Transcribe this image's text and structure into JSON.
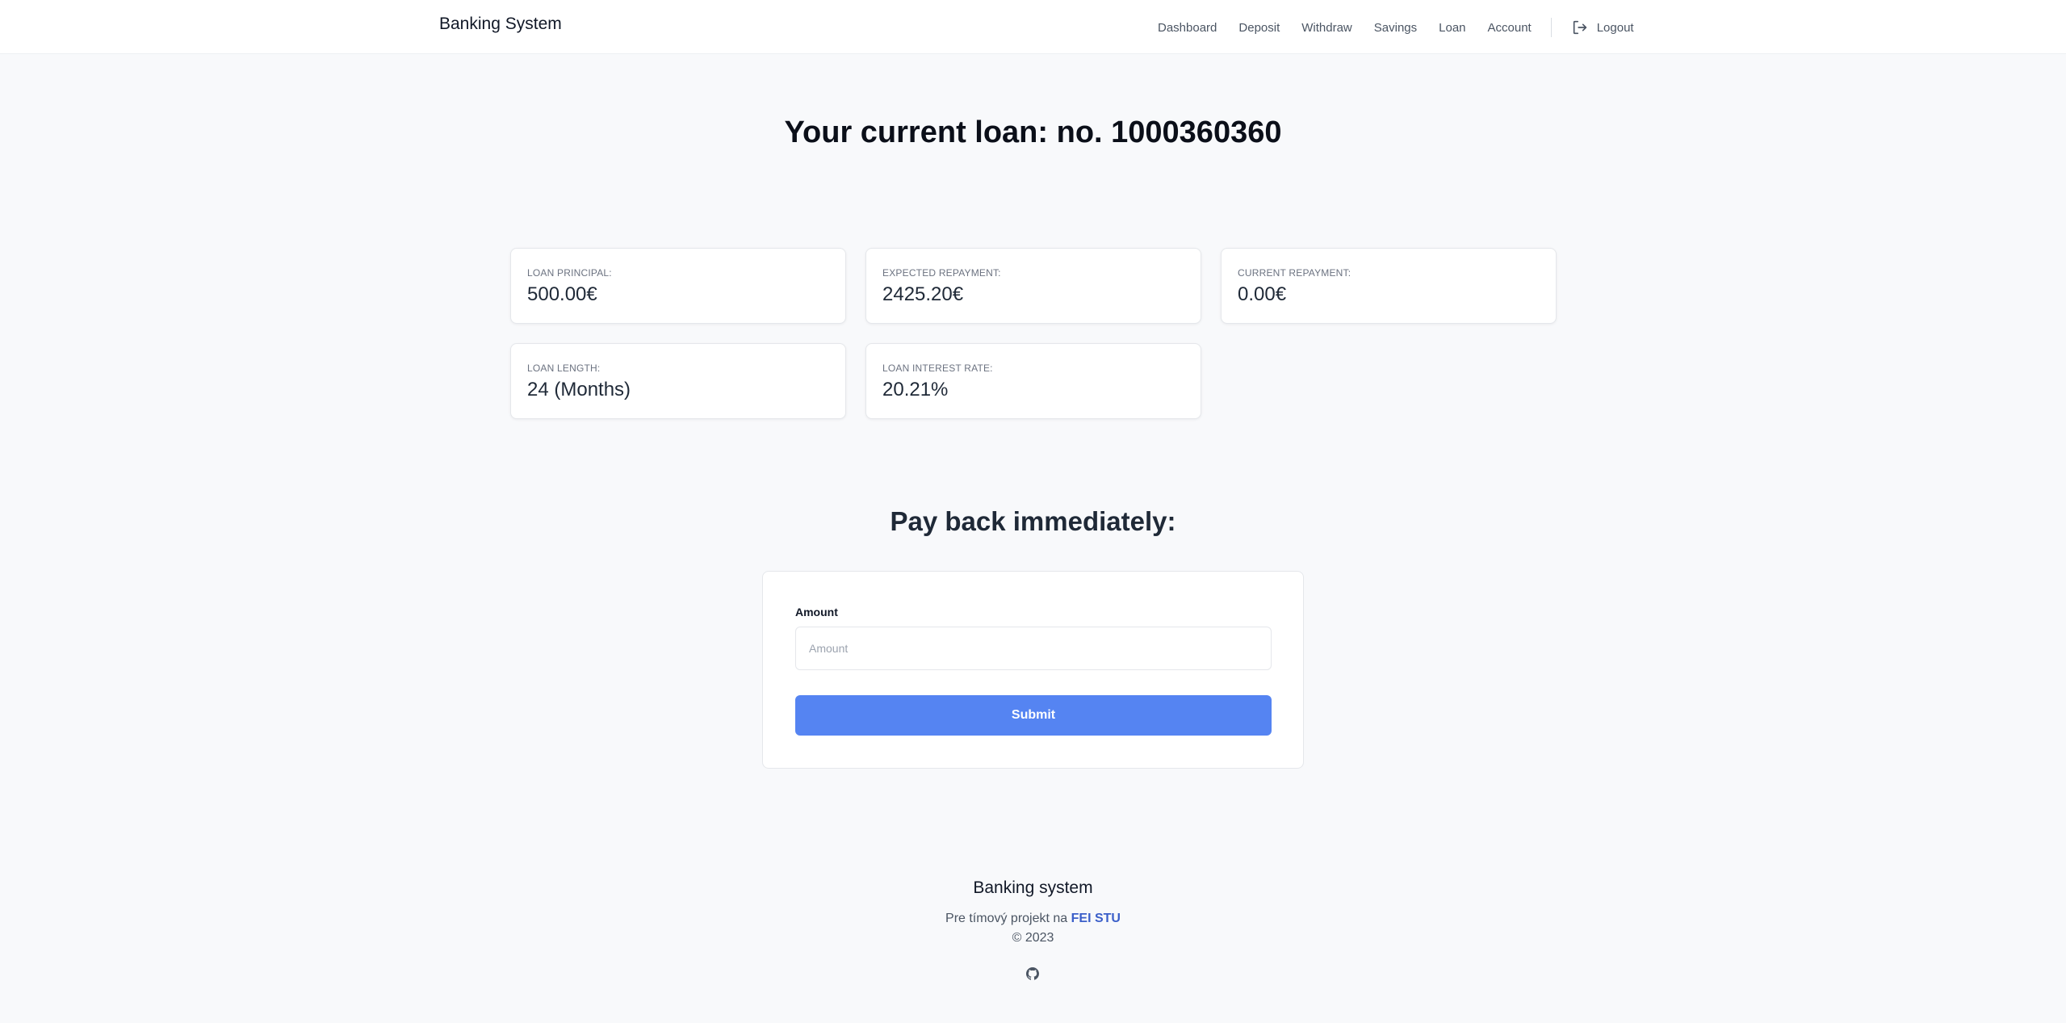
{
  "nav": {
    "brand": "Banking System",
    "links": [
      "Dashboard",
      "Deposit",
      "Withdraw",
      "Savings",
      "Loan",
      "Account"
    ],
    "logout_label": "Logout",
    "logout_icon": "logout-icon"
  },
  "loan": {
    "title": "Your current loan: no. 1000360360",
    "cards": [
      {
        "label": "LOAN PRINCIPAL:",
        "value": "500.00€"
      },
      {
        "label": "EXPECTED REPAYMENT:",
        "value": "2425.20€"
      },
      {
        "label": "CURRENT REPAYMENT:",
        "value": "0.00€"
      },
      {
        "label": "LOAN LENGTH:",
        "value": "24 (Months)"
      },
      {
        "label": "LOAN INTEREST RATE:",
        "value": "20.21%"
      }
    ]
  },
  "payback": {
    "title": "Pay back immediately:",
    "amount_label": "Amount",
    "amount_placeholder": "Amount",
    "amount_value": "",
    "submit_label": "Submit"
  },
  "footer": {
    "title": "Banking system",
    "text_prefix": "Pre tímový projekt na",
    "link_text": "FEI STU",
    "copyright": "© 2023",
    "github_icon": "github-icon"
  },
  "colors": {
    "accent": "#5584f2",
    "link": "#3b5fc9",
    "background": "#f8f9fb"
  }
}
